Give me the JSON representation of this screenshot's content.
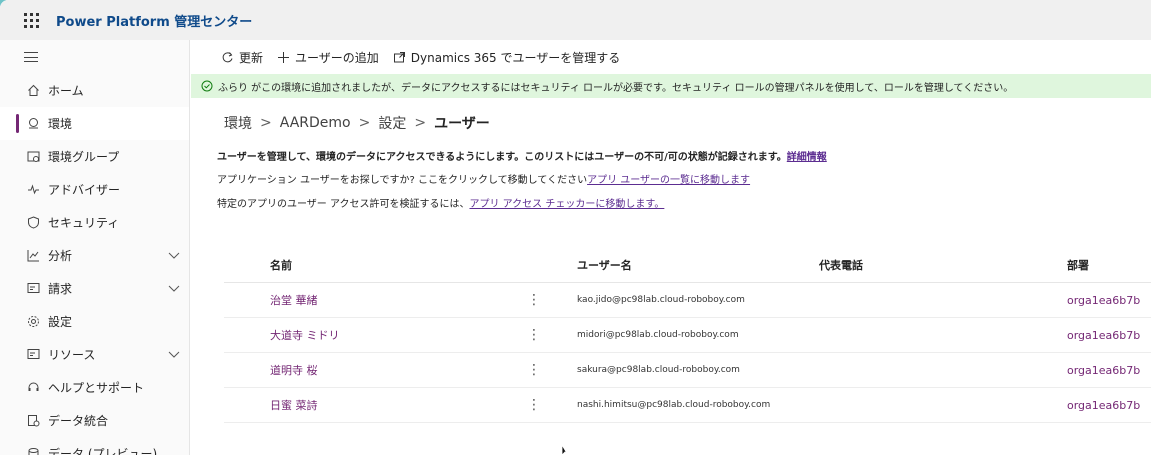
{
  "app": {
    "title": "Power Platform 管理センター"
  },
  "sidebar": {
    "items": [
      {
        "label": "ホーム",
        "icon": "home-icon",
        "active": false,
        "chevron": false
      },
      {
        "label": "環境",
        "icon": "environments-icon",
        "active": true,
        "chevron": false
      },
      {
        "label": "環境グループ",
        "icon": "environment-groups-icon",
        "active": false,
        "chevron": false
      },
      {
        "label": "アドバイザー",
        "icon": "advisor-icon",
        "active": false,
        "chevron": false
      },
      {
        "label": "セキュリティ",
        "icon": "shield-icon",
        "active": false,
        "chevron": false
      },
      {
        "label": "分析",
        "icon": "analytics-icon",
        "active": false,
        "chevron": true
      },
      {
        "label": "請求",
        "icon": "billing-icon",
        "active": false,
        "chevron": true
      },
      {
        "label": "設定",
        "icon": "gear-icon",
        "active": false,
        "chevron": false
      },
      {
        "label": "リソース",
        "icon": "resources-icon",
        "active": false,
        "chevron": true
      },
      {
        "label": "ヘルプとサポート",
        "icon": "headset-icon",
        "active": false,
        "chevron": false
      },
      {
        "label": "データ統合",
        "icon": "data-integration-icon",
        "active": false,
        "chevron": false
      },
      {
        "label": "データ (プレビュー)",
        "icon": "data-icon",
        "active": false,
        "chevron": false
      }
    ]
  },
  "toolbar": {
    "refresh_label": "更新",
    "add_user_label": "ユーザーの追加",
    "manage_d365_label": "Dynamics 365 でユーザーを管理する"
  },
  "banner": {
    "text": "ふらり がこの環境に追加されましたが、データにアクセスするにはセキュリティ ロールが必要です。セキュリティ ロールの管理パネルを使用して、ロールを管理してください。"
  },
  "breadcrumb": {
    "items": [
      "環境",
      "AARDemo",
      "設定"
    ],
    "current": "ユーザー",
    "separator": ">"
  },
  "description": {
    "line1": "ユーザーを管理して、環境のデータにアクセスできるようにします。このリストにはユーザーの不可/可の状態が記録されます。",
    "line1_link": "詳細情報",
    "line2": "アプリケーション ユーザーをお探しですか? ここをクリックして移動してください",
    "line2_link": "アプリ ユーザーの一覧に移動します",
    "line3": "特定のアプリのユーザー アクセス許可を検証するには、",
    "line3_link": "アプリ アクセス チェッカーに移動します。"
  },
  "table": {
    "headers": {
      "name": "名前",
      "username": "ユーザー名",
      "phone": "代表電話",
      "dept": "部署"
    },
    "rows": [
      {
        "name": "治堂 華緒",
        "more": "⋮",
        "username": "kao.jido@pc98lab.cloud-roboboy.com",
        "phone": "",
        "dept": "orga1ea6b7b"
      },
      {
        "name": "大道寺 ミドリ",
        "more": "⋮",
        "username": "midori@pc98lab.cloud-roboboy.com",
        "phone": "",
        "dept": "orga1ea6b7b"
      },
      {
        "name": "道明寺 桜",
        "more": "⋮",
        "username": "sakura@pc98lab.cloud-roboboy.com",
        "phone": "",
        "dept": "orga1ea6b7b"
      },
      {
        "name": "日蜜 菜詩",
        "more": "⋮",
        "username": "nashi.himitsu@pc98lab.cloud-roboboy.com",
        "phone": "",
        "dept": "orga1ea6b7b"
      }
    ]
  },
  "colors": {
    "accent": "#742774",
    "link": "#5c2d91",
    "banner_bg": "#dff6dd",
    "title": "#0f4a8a"
  }
}
